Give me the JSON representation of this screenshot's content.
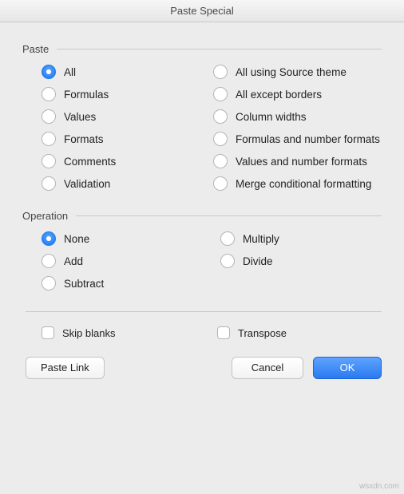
{
  "title": "Paste Special",
  "groups": {
    "paste": {
      "label": "Paste",
      "selected": "all",
      "options": {
        "all": "All",
        "all_source_theme": "All using Source theme",
        "formulas": "Formulas",
        "all_except_borders": "All except borders",
        "values": "Values",
        "column_widths": "Column widths",
        "formats": "Formats",
        "formulas_num_fmt": "Formulas and number formats",
        "comments": "Comments",
        "values_num_fmt": "Values and number formats",
        "validation": "Validation",
        "merge_cond_fmt": "Merge conditional formatting"
      }
    },
    "operation": {
      "label": "Operation",
      "selected": "none",
      "options": {
        "none": "None",
        "multiply": "Multiply",
        "add": "Add",
        "divide": "Divide",
        "subtract": "Subtract"
      }
    }
  },
  "checkboxes": {
    "skip_blanks": {
      "label": "Skip blanks",
      "checked": false
    },
    "transpose": {
      "label": "Transpose",
      "checked": false
    }
  },
  "buttons": {
    "paste_link": "Paste Link",
    "cancel": "Cancel",
    "ok": "OK"
  },
  "watermark": "wsxdn.com"
}
